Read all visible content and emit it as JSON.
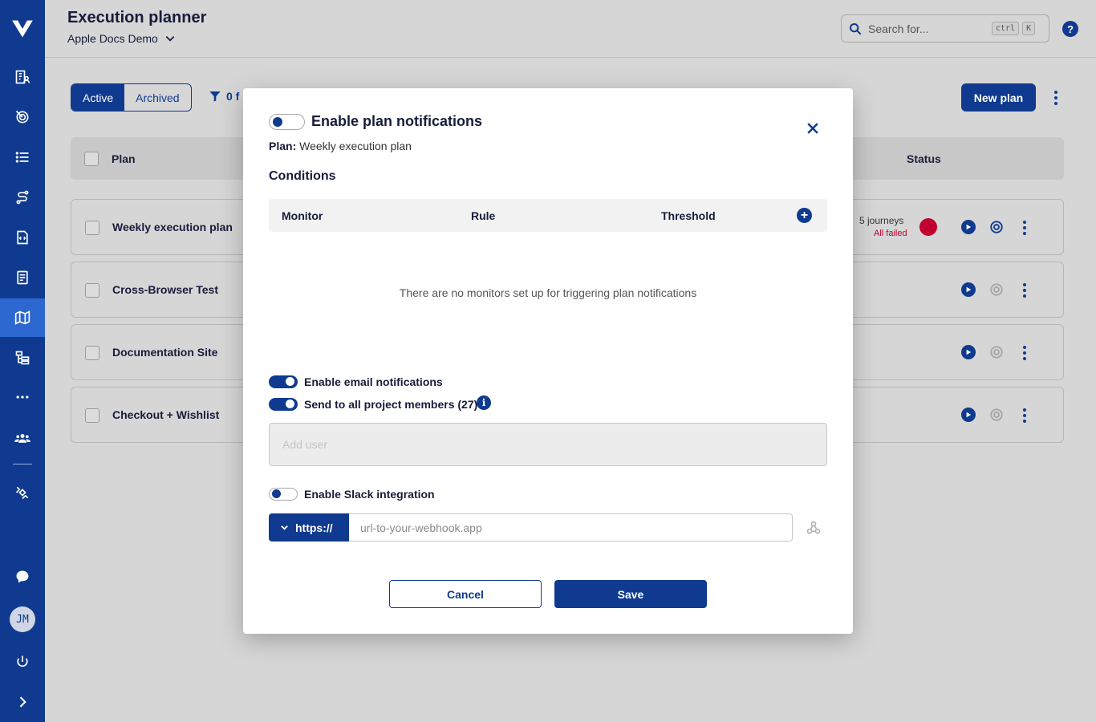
{
  "header": {
    "title": "Execution planner",
    "project": "Apple Docs Demo",
    "search_placeholder": "Search for...",
    "shortcut_keys": [
      "ctrl",
      "K"
    ],
    "help_label": "?"
  },
  "sidebar": {
    "items": [
      {
        "icon": "logo-icon"
      },
      {
        "icon": "building-user-icon"
      },
      {
        "icon": "target-icon"
      },
      {
        "icon": "list-icon"
      },
      {
        "icon": "route-icon"
      },
      {
        "icon": "code-file-icon"
      },
      {
        "icon": "checklist-icon"
      },
      {
        "icon": "map-icon",
        "active": true
      },
      {
        "icon": "hierarchy-icon"
      },
      {
        "icon": "more-icon"
      },
      {
        "icon": "team-icon"
      },
      {
        "icon": "satellite-icon"
      },
      {
        "icon": "chat-icon"
      },
      {
        "icon": "avatar",
        "initials": "JM"
      },
      {
        "icon": "power-icon"
      },
      {
        "icon": "expand-icon"
      }
    ]
  },
  "toolbar": {
    "segments": [
      {
        "label": "Active",
        "selected": true
      },
      {
        "label": "Archived",
        "selected": false
      }
    ],
    "filter_text": "0 f",
    "new_plan_label": "New plan"
  },
  "table": {
    "columns": {
      "plan": "Plan",
      "status": "Status"
    },
    "rows": [
      {
        "name": "Weekly execution plan",
        "journeys": "5 journeys",
        "status": "All failed"
      },
      {
        "name": "Cross-Browser Test"
      },
      {
        "name": "Documentation Site"
      },
      {
        "name": "Checkout + Wishlist"
      }
    ]
  },
  "modal": {
    "title": "Enable plan notifications",
    "plan_label": "Plan:",
    "plan_name": "Weekly execution plan",
    "conditions_title": "Conditions",
    "columns": {
      "monitor": "Monitor",
      "rule": "Rule",
      "threshold": "Threshold"
    },
    "empty_message": "There are no monitors set up for triggering plan notifications",
    "email_toggle_label": "Enable email notifications",
    "send_all_label": "Send to all project members (27)",
    "add_user_placeholder": "Add user",
    "slack_toggle_label": "Enable Slack integration",
    "protocol": "https://",
    "webhook_placeholder": "url-to-your-webhook.app",
    "cancel_label": "Cancel",
    "save_label": "Save"
  },
  "colors": {
    "primary": "#0f3a8f",
    "sidebar_active": "#2d67d0",
    "error": "#c2002f"
  }
}
